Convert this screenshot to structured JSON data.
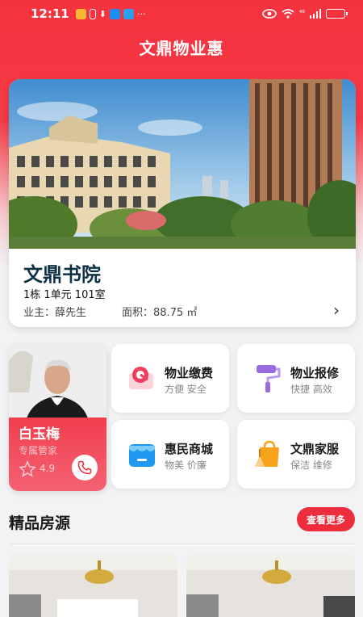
{
  "status_bar": {
    "time": "12:11",
    "signal_text": "⁴⁶"
  },
  "app": {
    "title": "文鼎物业惠"
  },
  "property": {
    "name": "文鼎书院",
    "unit": "1栋 1单元 101室",
    "owner_label": "业主：",
    "owner_name": "薛先生",
    "area_label": "面积：",
    "area_value": "88.75 ㎡"
  },
  "manager": {
    "name": "白玉梅",
    "role": "专属管家",
    "rating": "4.9"
  },
  "services": [
    {
      "title": "物业缴费",
      "subtitle": "方便 安全",
      "icon": "payment-icon"
    },
    {
      "title": "物业报修",
      "subtitle": "快捷 高效",
      "icon": "paint-roller-icon"
    },
    {
      "title": "惠民商城",
      "subtitle": "物美 价廉",
      "icon": "shop-icon"
    },
    {
      "title": "文鼎家服",
      "subtitle": "保洁 维修",
      "icon": "cleaning-bag-icon"
    }
  ],
  "listings": {
    "title": "精品房源",
    "more_label": "查看更多"
  },
  "colors": {
    "brand_red": "#f5333f",
    "button_red": "#ee2d3c",
    "title_navy": "#0c3147"
  }
}
